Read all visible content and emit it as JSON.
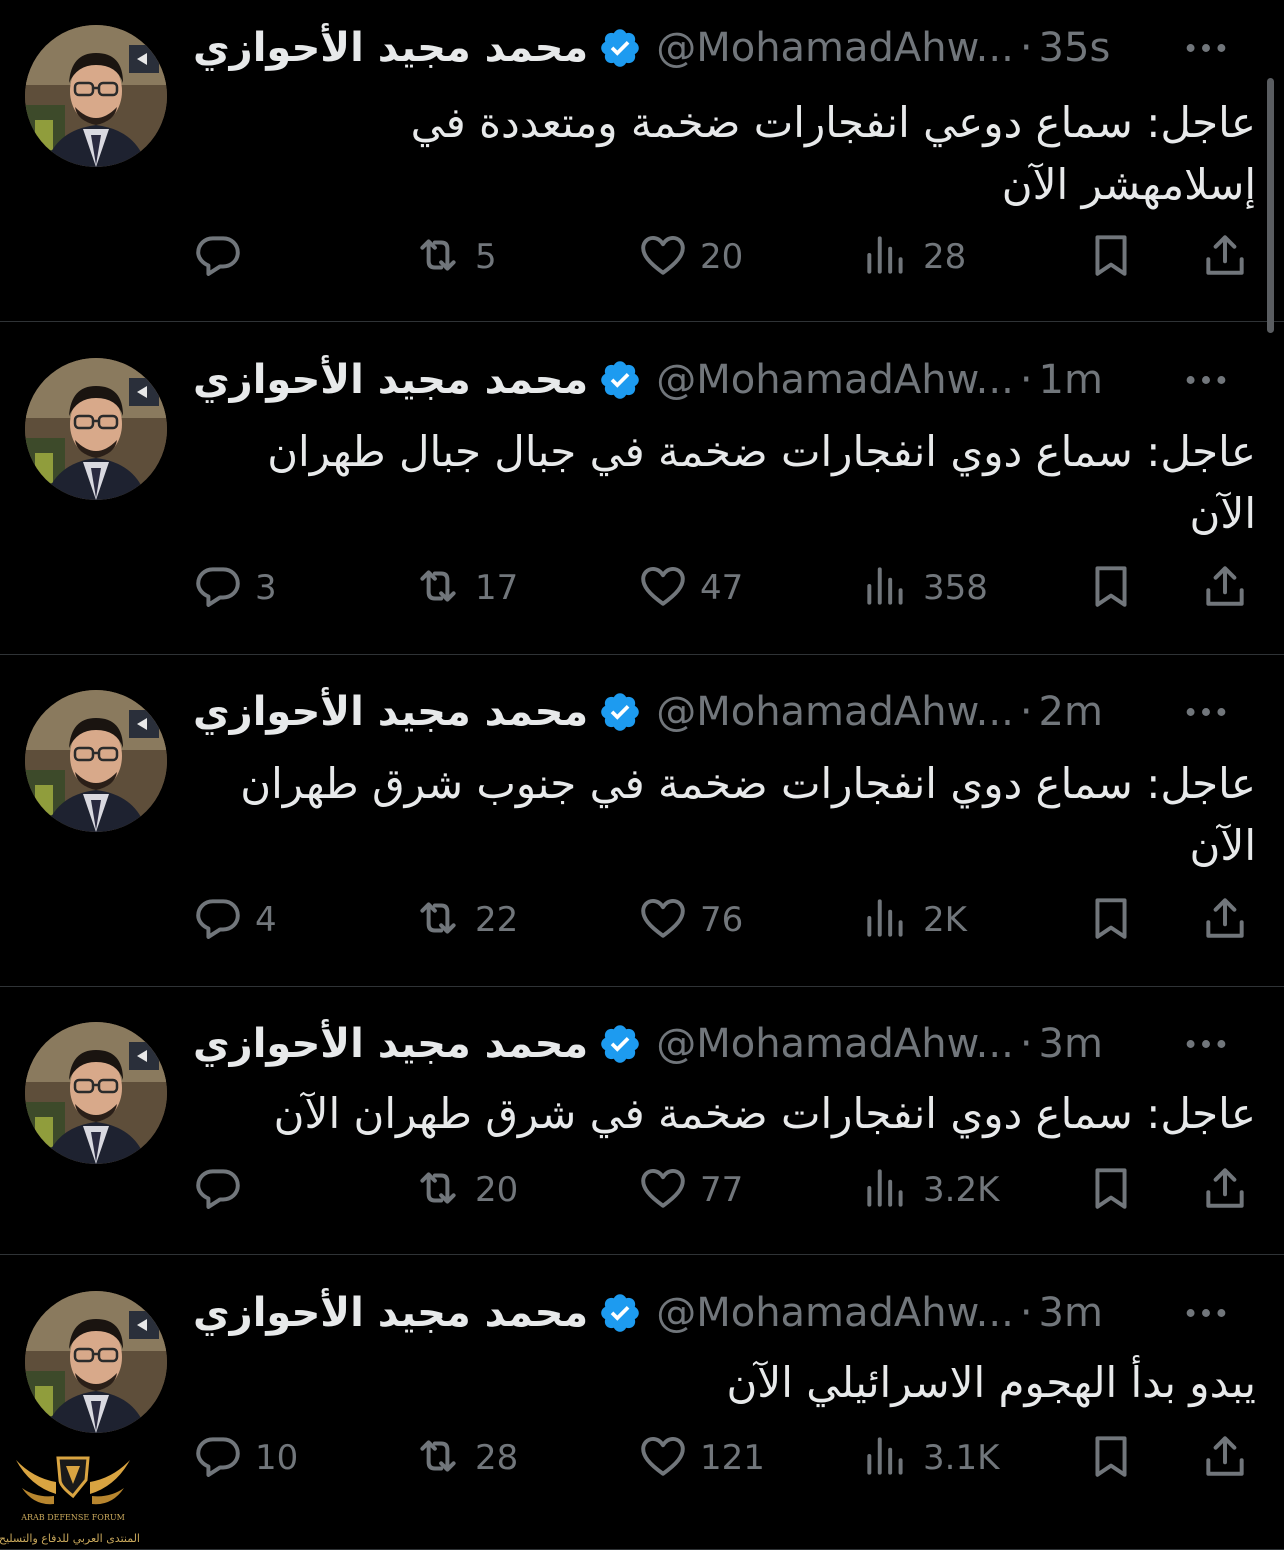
{
  "colors": {
    "background": "#000000",
    "text": "#e7e9ea",
    "muted": "#71767b",
    "divider": "#2f3336",
    "verified": "#1d9bf0"
  },
  "tweets": [
    {
      "name": "محمد مجيد الأحوازي",
      "handle": "@MohamadAhw...",
      "time": "35s",
      "text_lines": [
        "عاجل: سماع دوعي انفجارات ضخمة ومتعددة في",
        "إسلامهشر الآن"
      ],
      "replies": "",
      "retweets": "5",
      "likes": "20",
      "views": "28"
    },
    {
      "name": "محمد مجيد الأحوازي",
      "handle": "@MohamadAhw...",
      "time": "1m",
      "text_lines": [
        "عاجل: سماع دوي انفجارات ضخمة في جبال جبال طهران",
        "الآن"
      ],
      "replies": "3",
      "retweets": "17",
      "likes": "47",
      "views": "358"
    },
    {
      "name": "محمد مجيد الأحوازي",
      "handle": "@MohamadAhw...",
      "time": "2m",
      "text_lines": [
        "عاجل: سماع دوي انفجارات ضخمة في جنوب شرق طهران",
        "الآن"
      ],
      "replies": "4",
      "retweets": "22",
      "likes": "76",
      "views": "2K"
    },
    {
      "name": "محمد مجيد الأحوازي",
      "handle": "@MohamadAhw...",
      "time": "3m",
      "text_lines": [
        "عاجل: سماع دوي انفجارات ضخمة في شرق طهران الآن"
      ],
      "replies": "",
      "retweets": "20",
      "likes": "77",
      "views": "3.2K"
    },
    {
      "name": "محمد مجيد الأحوازي",
      "handle": "@MohamadAhw...",
      "time": "3m",
      "text_lines": [
        "يبدو بدأ الهجوم الاسرائيلي الآن"
      ],
      "replies": "10",
      "retweets": "28",
      "likes": "121",
      "views": "3.1K"
    }
  ],
  "watermark": {
    "brand": "ARAB DEFENSE FORUM",
    "caption": "المنتدى العربي للدفاع والتسليح"
  },
  "icons": [
    "more-icon",
    "verified-badge-icon",
    "reply-icon",
    "retweet-icon",
    "like-icon",
    "views-icon",
    "bookmark-icon",
    "share-icon"
  ]
}
